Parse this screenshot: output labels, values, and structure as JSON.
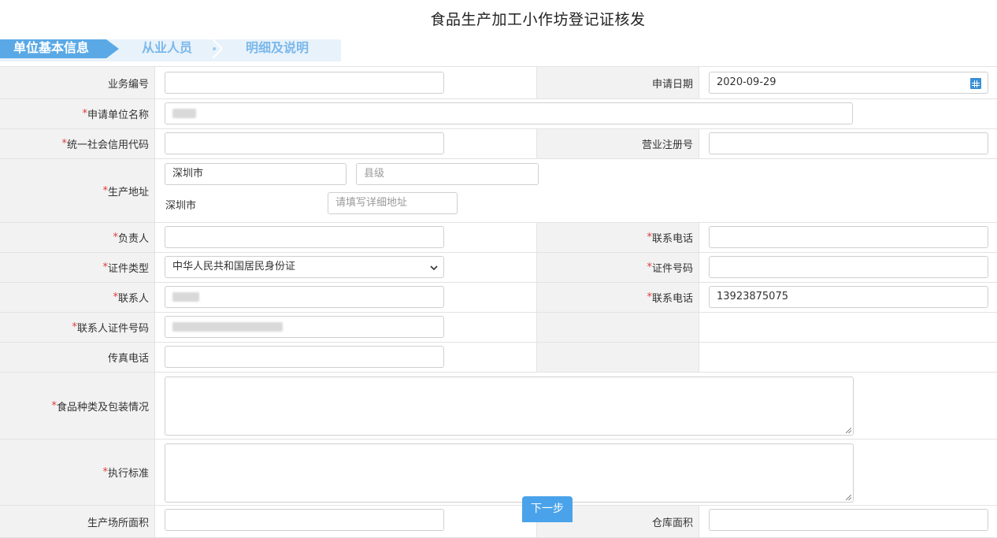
{
  "page": {
    "title": "食品生产加工小作坊登记证核发"
  },
  "steps": [
    {
      "label": "单位基本信息",
      "active": true
    },
    {
      "label": "从业人员",
      "active": false
    },
    {
      "label": "明细及说明",
      "active": false
    }
  ],
  "step_separator": "•",
  "form": {
    "business_no": {
      "label": "业务编号",
      "value": ""
    },
    "apply_date": {
      "label": "申请日期",
      "value": "2020-09-29",
      "icon": "calendar-icon"
    },
    "unit_name": {
      "req": "*",
      "label": "申请单位名称",
      "value": ""
    },
    "credit_code": {
      "req": "*",
      "label": "统一社会信用代码",
      "value": ""
    },
    "reg_no": {
      "label": "营业注册号",
      "value": ""
    },
    "address": {
      "req": "*",
      "label": "生产地址",
      "city_select": "深圳市",
      "county_placeholder": "县级",
      "city_text": "深圳市",
      "detail_placeholder": "请填写详细地址"
    },
    "principal": {
      "req": "*",
      "label": "负责人",
      "value": ""
    },
    "principal_phone": {
      "req": "*",
      "label": "联系电话",
      "value": ""
    },
    "id_type": {
      "req": "*",
      "label": "证件类型",
      "value": "中华人民共和国居民身份证"
    },
    "id_no": {
      "req": "*",
      "label": "证件号码",
      "value": ""
    },
    "contact": {
      "req": "*",
      "label": "联系人",
      "value": ""
    },
    "contact_phone": {
      "req": "*",
      "label": "联系电话",
      "value": "13923875075"
    },
    "contact_id": {
      "req": "*",
      "label": "联系人证件号码",
      "value": ""
    },
    "fax": {
      "label": "传真电话",
      "value": ""
    },
    "food_types": {
      "req": "*",
      "label": "食品种类及包装情况",
      "value": ""
    },
    "standard": {
      "req": "*",
      "label": "执行标准",
      "value": ""
    },
    "site_area": {
      "label": "生产场所面积",
      "value": ""
    },
    "warehouse_area": {
      "label": "仓库面积",
      "value": ""
    }
  },
  "buttons": {
    "next": "下一步"
  }
}
